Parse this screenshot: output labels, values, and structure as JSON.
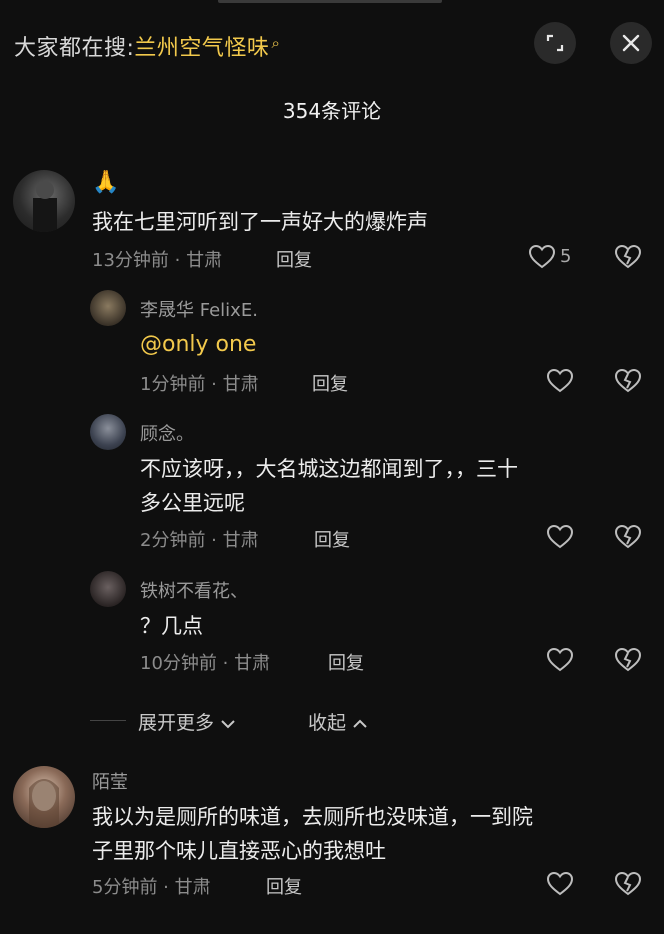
{
  "header": {
    "search_prefix": "大家都在搜:",
    "search_keyword": "兰州空气怪味",
    "comment_count": "354条评论"
  },
  "comments": [
    {
      "username": "🙏",
      "text": "我在七里河听到了一声好大的爆炸声",
      "time_location": "13分钟前 · 甘肃",
      "reply_label": "回复",
      "likes": "5"
    },
    {
      "username": "李晟华 FelixE.",
      "text": "@only one",
      "time_location": "1分钟前 · 甘肃",
      "reply_label": "回复"
    },
    {
      "username": "顾念。",
      "text_line1": "不应该呀，，大名城这边都闻到了，，三十",
      "text_line2": "多公里远呢",
      "time_location": "2分钟前 · 甘肃",
      "reply_label": "回复"
    },
    {
      "username": "铁树不看花、",
      "text": "？几点",
      "time_location": "10分钟前 · 甘肃",
      "reply_label": "回复"
    },
    {
      "username": "陌莹",
      "text_line1": "我以为是厕所的味道，去厕所也没味道，一到院",
      "text_line2": "子里那个味儿直接恶心的我想吐",
      "time_location": "5分钟前 · 甘肃",
      "reply_label": "回复"
    }
  ],
  "thread": {
    "expand_label": "展开更多",
    "collapse_label": "收起"
  },
  "colors": {
    "background": "#0f0f0f",
    "accent": "#f2c94c"
  }
}
